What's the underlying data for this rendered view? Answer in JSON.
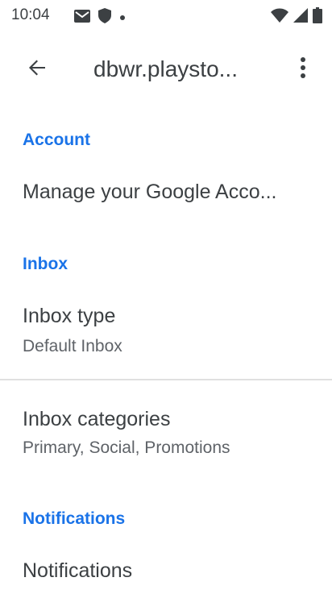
{
  "status_bar": {
    "time": "10:04",
    "icons": [
      "gmail-icon",
      "shield-icon",
      "dot-icon",
      "wifi-icon",
      "signal-icon",
      "battery-icon"
    ]
  },
  "app_bar": {
    "title": "dbwr.playsto...",
    "back_icon": "arrow-left-icon",
    "menu_icon": "more-vert-icon"
  },
  "settings": {
    "account_header": "Account",
    "manage_account": "Manage your Google Acco...",
    "inbox_header": "Inbox",
    "inbox_type_title": "Inbox type",
    "inbox_type_value": "Default Inbox",
    "inbox_categories_title": "Inbox categories",
    "inbox_categories_value": "Primary, Social, Promotions",
    "notifications_header": "Notifications",
    "notifications_title": "Notifications"
  },
  "colors": {
    "accent": "#1a73e8",
    "text": "#3c4043",
    "secondary_text": "#5f6368",
    "divider": "#e0e0e0"
  }
}
